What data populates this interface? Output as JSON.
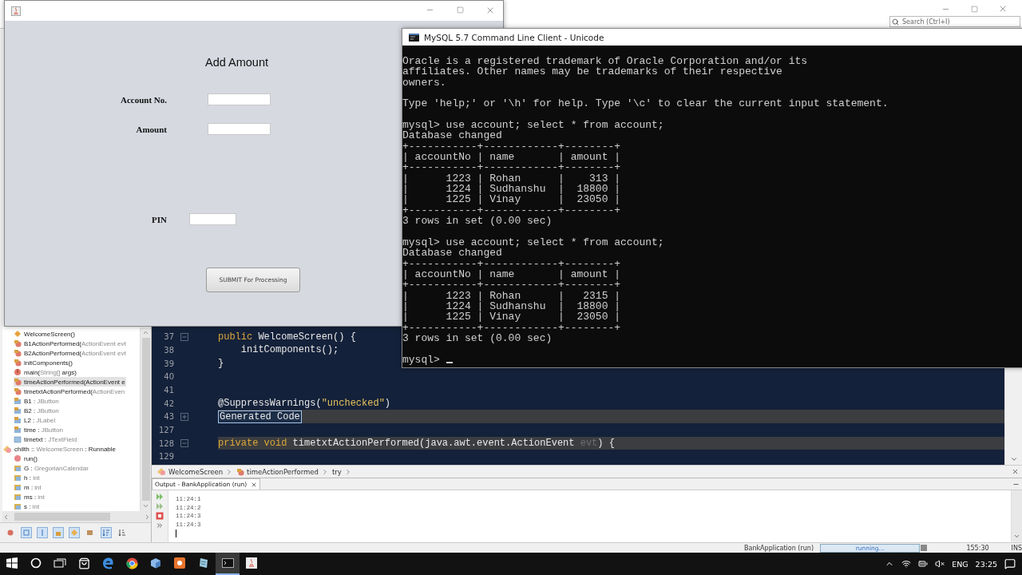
{
  "ide": {
    "search": {
      "placeholder": "Search (Ctrl+I)"
    },
    "navigator": {
      "groups": [
        {
          "children": [
            {
              "kind": "constructor",
              "name": "WelcomeScreen()",
              "selected": false
            },
            {
              "kind": "method",
              "name": "B1ActionPerformed(",
              "detail": "ActionEvent evt",
              "selected": false
            },
            {
              "kind": "method",
              "name": "B2ActionPerformed(",
              "detail": "ActionEvent evt",
              "selected": false
            },
            {
              "kind": "method",
              "name": "initComponents()",
              "selected": false
            },
            {
              "kind": "static-method",
              "name": "main(",
              "detail": "String[]",
              "tail": " args)",
              "selected": false
            },
            {
              "kind": "method",
              "name": "timeActionPerformed(ActionEvent e",
              "selected": true
            },
            {
              "kind": "method",
              "name": "timetxtActionPerformed(",
              "detail": "ActionEven",
              "selected": false
            },
            {
              "kind": "field",
              "name": "B1 : ",
              "detail": "JButton",
              "selected": false
            },
            {
              "kind": "field",
              "name": "B2 : ",
              "detail": "JButton",
              "selected": false
            },
            {
              "kind": "field",
              "name": "L2 : ",
              "detail": "JLabel",
              "selected": false
            },
            {
              "kind": "field",
              "name": "time : ",
              "detail": "JButton",
              "selected": false
            },
            {
              "kind": "plain-field",
              "name": "timetxt : ",
              "detail": "JTextField",
              "selected": false
            }
          ]
        },
        {
          "label": {
            "kind": "class",
            "name": "chilth :: ",
            "detail": "WelcomeScreen",
            "tail": " : Runnable",
            "selected": false
          },
          "children": [
            {
              "kind": "public-method",
              "name": "run()",
              "selected": false
            },
            {
              "kind": "package-field",
              "name": "G : ",
              "detail": "GregorianCalendar",
              "selected": false
            },
            {
              "kind": "package-field",
              "name": "h : ",
              "detail": "int",
              "selected": false
            },
            {
              "kind": "package-field",
              "name": "m : ",
              "detail": "int",
              "selected": false
            },
            {
              "kind": "package-field",
              "name": "ms : ",
              "detail": "int",
              "selected": false
            },
            {
              "kind": "package-field",
              "name": "s : ",
              "detail": "int",
              "selected": false
            }
          ]
        }
      ],
      "toolbar": [
        {
          "kind": "members",
          "selected": false
        },
        {
          "kind": "fields",
          "selected": true
        },
        {
          "kind": "static",
          "selected": true
        },
        {
          "kind": "lock",
          "selected": true
        },
        {
          "kind": "inherited",
          "selected": true
        },
        {
          "kind": "javadoc",
          "selected": false
        },
        {
          "kind": "sort-a",
          "selected": true
        },
        {
          "kind": "sort-b",
          "selected": false
        }
      ]
    },
    "editor": {
      "lines": [
        {
          "number": "37",
          "expanded": true,
          "highlighted": false,
          "tokens": [
            {
              "kind": "keyword",
              "text": "public"
            },
            {
              "kind": "plain",
              "text": " WelcomeScreen() {"
            }
          ]
        },
        {
          "number": "38",
          "highlighted": false,
          "tokens": [
            {
              "kind": "plain",
              "text": "    initComponents();"
            }
          ]
        },
        {
          "number": "39",
          "highlighted": false,
          "tokens": [
            {
              "kind": "plain",
              "text": "}"
            }
          ]
        },
        {
          "number": "40",
          "highlighted": false
        },
        {
          "number": "41",
          "highlighted": false
        },
        {
          "number": "42",
          "highlighted": false,
          "tokens": [
            {
              "kind": "plain",
              "text": "@SuppressWarnings("
            },
            {
              "kind": "string",
              "text": "\"unchecked\""
            },
            {
              "kind": "plain",
              "text": ")"
            }
          ]
        },
        {
          "number": "43",
          "expanded": false,
          "highlighted": true,
          "tokens": [
            {
              "kind": "folded",
              "text": "Generated Code"
            }
          ]
        },
        {
          "number": "127",
          "highlighted": false
        },
        {
          "number": "128",
          "expanded": true,
          "highlighted": true,
          "tokens": [
            {
              "kind": "keyword",
              "text": "private void"
            },
            {
              "kind": "plain",
              "text": " timetxtActionPerformed(java.awt.event.ActionEvent "
            },
            {
              "kind": "param",
              "text": "evt"
            },
            {
              "kind": "plain",
              "text": ") {"
            }
          ]
        },
        {
          "number": "129",
          "highlighted": false
        }
      ]
    },
    "breadcrumb": [
      {
        "kind": "class",
        "text": "WelcomeScreen"
      },
      {
        "kind": "method",
        "text": "timeActionPerformed"
      },
      {
        "kind": "none",
        "text": "try"
      }
    ],
    "output": {
      "tab": "Output - BankApplication (run)",
      "lines": [
        "11:24:1",
        "11:24:2",
        "11:24:3",
        "11:24:3"
      ]
    },
    "status": {
      "project": "BankApplication (run)",
      "progress": "running...",
      "level": 1,
      "position": "155:30",
      "mode": "INS"
    }
  },
  "form_window": {
    "heading": "Add Amount",
    "fields": [
      {
        "kind": "text",
        "label": "Account No."
      },
      {
        "kind": "text",
        "label": "Amount"
      },
      {
        "kind": "pin",
        "label": "PIN"
      }
    ],
    "button": "SUBMIT For Processing"
  },
  "console_window": {
    "title": "MySQL 5.7 Command Line Client - Unicode",
    "blocks": [
      [
        "Oracle is a registered trademark of Oracle Corporation and/or its",
        "affiliates. Other names may be trademarks of their respective",
        "owners."
      ],
      [
        "Type 'help;' or '\\h' for help. Type '\\c' to clear the current input statement."
      ],
      [
        "mysql> use account; select * from account;",
        "Database changed",
        "+-----------+------------+--------+",
        "| accountNo | name       | amount |",
        "+-----------+------------+--------+",
        "|      1223 | Rohan      |    313 |",
        "|      1224 | Sudhanshu  |  18800 |",
        "|      1225 | Vinay      |  23050 |",
        "+-----------+------------+--------+",
        "3 rows in set (0.00 sec)"
      ],
      [
        "mysql> use account; select * from account;",
        "Database changed",
        "+-----------+------------+--------+",
        "| accountNo | name       | amount |",
        "+-----------+------------+--------+",
        "|      1223 | Rohan      |   2315 |",
        "|      1224 | Sudhanshu  |  18800 |",
        "|      1225 | Vinay      |  23050 |",
        "+-----------+------------+--------+",
        "3 rows in set (0.00 sec)"
      ]
    ],
    "prompt": "mysql>",
    "cursor": true
  },
  "taskbar": {
    "apps": [
      {
        "kind": "start",
        "selected": false
      },
      {
        "kind": "search",
        "selected": false
      },
      {
        "kind": "task-view",
        "selected": false
      },
      {
        "kind": "store",
        "selected": false
      },
      {
        "kind": "edge",
        "selected": false
      },
      {
        "kind": "chrome",
        "selected": false
      },
      {
        "kind": "cube",
        "selected": false
      },
      {
        "kind": "orange",
        "selected": false
      },
      {
        "kind": "notes",
        "selected": false
      },
      {
        "kind": "console",
        "selected": true
      },
      {
        "kind": "java",
        "selected": false
      }
    ],
    "language": "ENG",
    "time": "23:25"
  }
}
